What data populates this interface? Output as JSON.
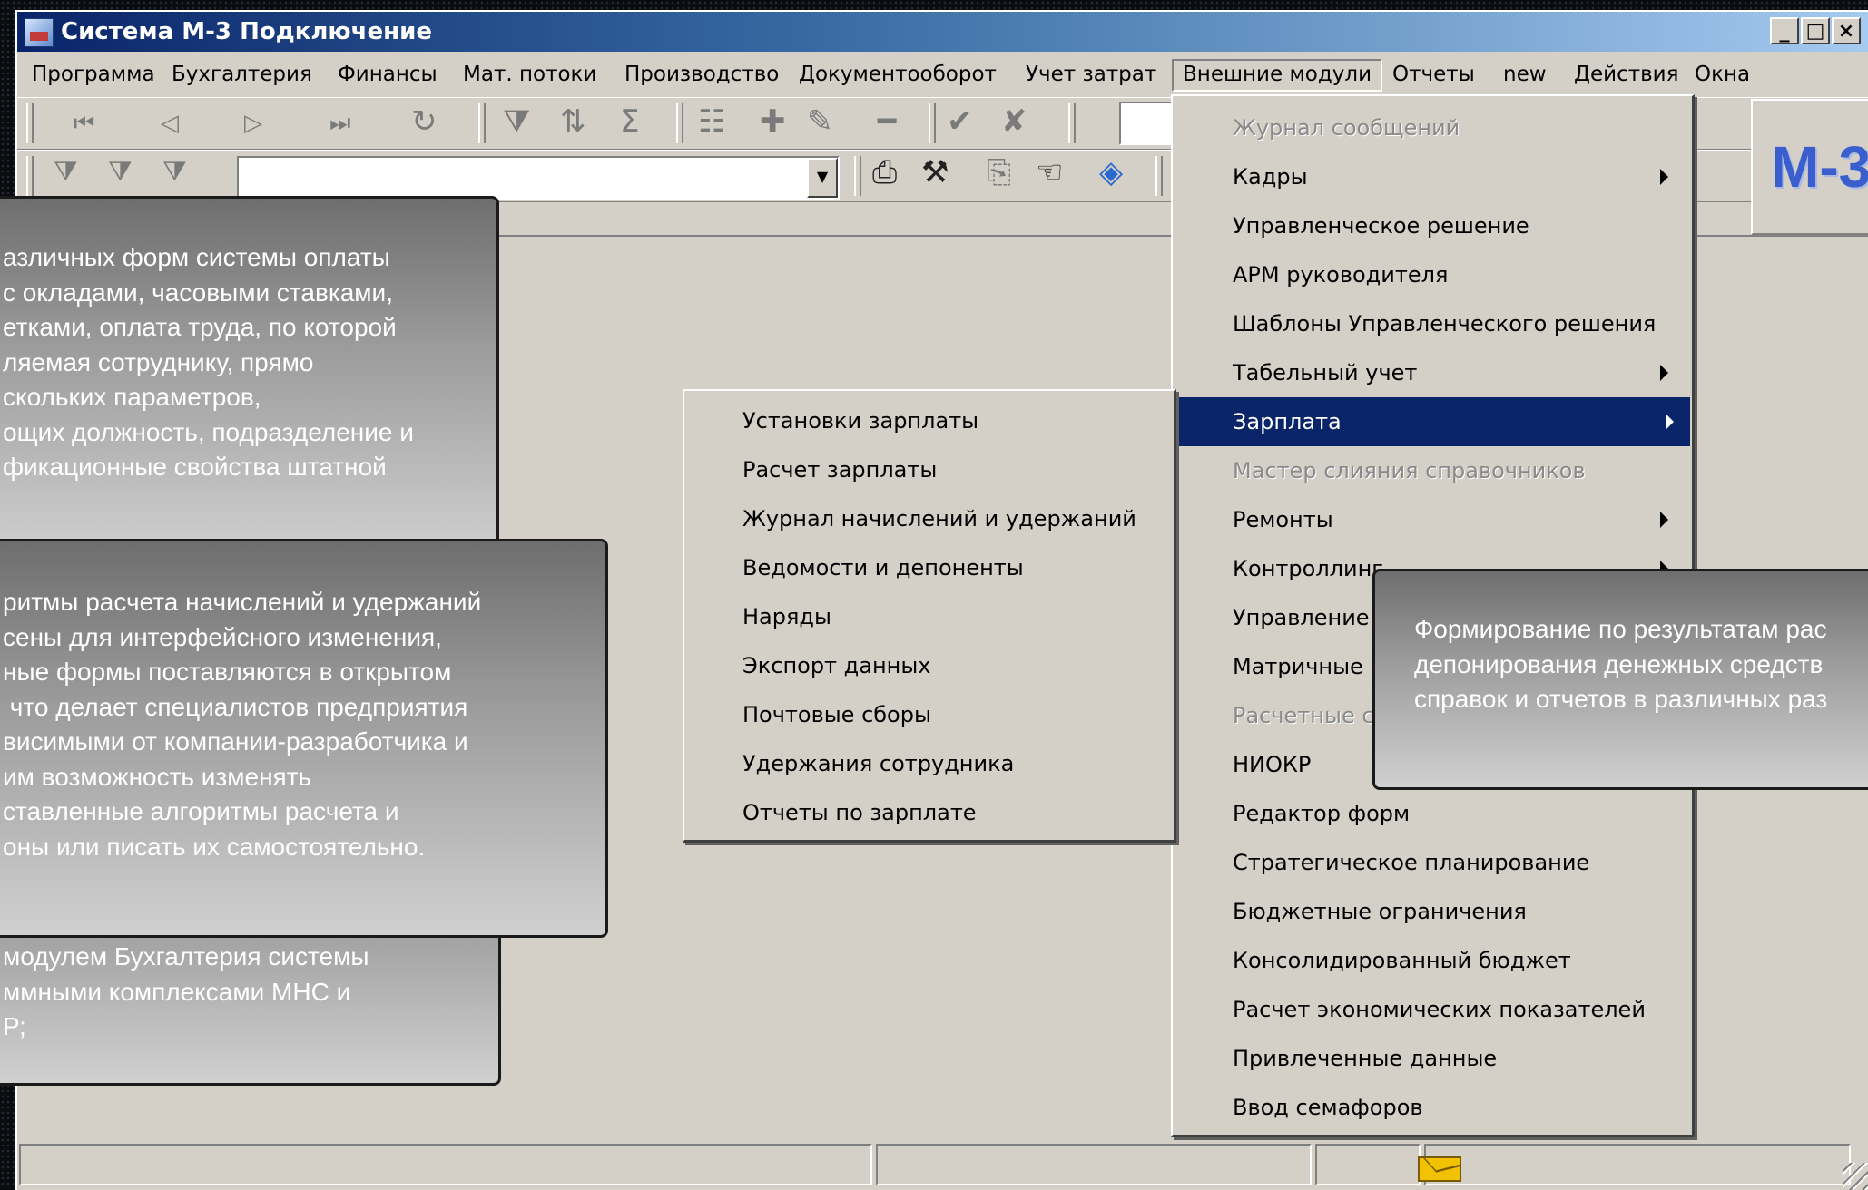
{
  "window": {
    "title": "Система М-3 Подключение",
    "controls": [
      "_",
      "□",
      "×"
    ]
  },
  "menubar": {
    "items": [
      "Программа",
      "Бухгалтерия",
      "Финансы",
      "Мат. потоки",
      "Производство",
      "Документооборот",
      "Учет затрат",
      "Внешние модули",
      "Отчеты",
      "new",
      "Действия",
      "Окна"
    ],
    "active": "Внешние модули"
  },
  "toolbar": {
    "icons": [
      "first-record-icon",
      "prev-record-icon",
      "next-record-icon",
      "last-record-icon",
      "refresh-icon",
      "filter-select-icon",
      "sort-icon",
      "sum-icon",
      "tree-icon",
      "add-icon",
      "edit-icon",
      "delete-icon",
      "apply-icon",
      "cancel-icon",
      "filter-icon",
      "filter-edit-icon",
      "filter-clear-icon",
      "print-icon",
      "tools-icon",
      "export-icon",
      "hand-icon",
      "navigate-icon"
    ],
    "filter_combo_value": ""
  },
  "logo": {
    "text": "M-3"
  },
  "external_menu": {
    "items": [
      {
        "label": "Журнал сообщений",
        "disabled": true,
        "submenu": false
      },
      {
        "label": "Кадры",
        "disabled": false,
        "submenu": true
      },
      {
        "label": "Управленческое решение",
        "disabled": false,
        "submenu": false
      },
      {
        "label": "АРМ руководителя",
        "disabled": false,
        "submenu": false
      },
      {
        "label": "Шаблоны Управленческого решения",
        "disabled": false,
        "submenu": false
      },
      {
        "label": "Табельный учет",
        "disabled": false,
        "submenu": true
      },
      {
        "label": "Зарплата",
        "disabled": false,
        "submenu": true,
        "selected": true
      },
      {
        "label": "Мастер слияния справочников",
        "disabled": true,
        "submenu": false
      },
      {
        "label": "Ремонты",
        "disabled": false,
        "submenu": true
      },
      {
        "label": "Контроллинг",
        "disabled": false,
        "submenu": true
      },
      {
        "label": "Управление п",
        "disabled": false,
        "submenu": false
      },
      {
        "label": "Матричные п",
        "disabled": false,
        "submenu": false
      },
      {
        "label": "Расчетные с",
        "disabled": true,
        "submenu": false
      },
      {
        "label": "НИОКР",
        "disabled": false,
        "submenu": false
      },
      {
        "label": "Редактор форм",
        "disabled": false,
        "submenu": false
      },
      {
        "label": "Стратегическое планирование",
        "disabled": false,
        "submenu": false
      },
      {
        "label": "Бюджетные ограничения",
        "disabled": false,
        "submenu": false
      },
      {
        "label": "Консолидированный бюджет",
        "disabled": false,
        "submenu": false
      },
      {
        "label": "Расчет экономических показателей",
        "disabled": false,
        "submenu": false
      },
      {
        "label": "Привлеченные данные",
        "disabled": false,
        "submenu": false
      },
      {
        "label": "Ввод семафоров",
        "disabled": false,
        "submenu": false
      }
    ]
  },
  "salary_submenu": {
    "items": [
      "Установки зарплаты",
      "Расчет зарплаты",
      "Журнал начислений и удержаний",
      "Ведомости и депоненты",
      "Наряды",
      "Экспорт данных",
      "Почтовые сборы",
      "Удержания сотрудника",
      "Отчеты по зарплате"
    ]
  },
  "callouts": {
    "top_left": [
      "азличных форм системы оплаты",
      "с окладами, часовыми ставками,",
      "етками, оплата труда, по которой",
      "ляемая сотруднику, прямо",
      "скольких параметров,",
      "ощих должность, подразделение и",
      "фикационные свойства штатной"
    ],
    "middle_left": [
      "ритмы расчета начислений и удержаний",
      "сены для интерфейсного изменения,",
      "ные формы поставляются в открытом",
      " что делает специалистов предприятия",
      "висимыми от компании-разработчика и",
      "им возможность изменять",
      "ставленные алгоритмы расчета и",
      "оны или писать их самостоятельно."
    ],
    "bottom_left": [
      "модулем Бухгалтерия системы",
      "ммными комплексами МНС и",
      "Р;"
    ],
    "right": [
      "Формирование по результатам рас",
      "депонирования денежных средств",
      "справок и отчетов в различных раз"
    ]
  },
  "colors": {
    "menu_highlight": "#0a246a",
    "window_face": "#d4d0c8",
    "logo": "#3a5fcd"
  }
}
